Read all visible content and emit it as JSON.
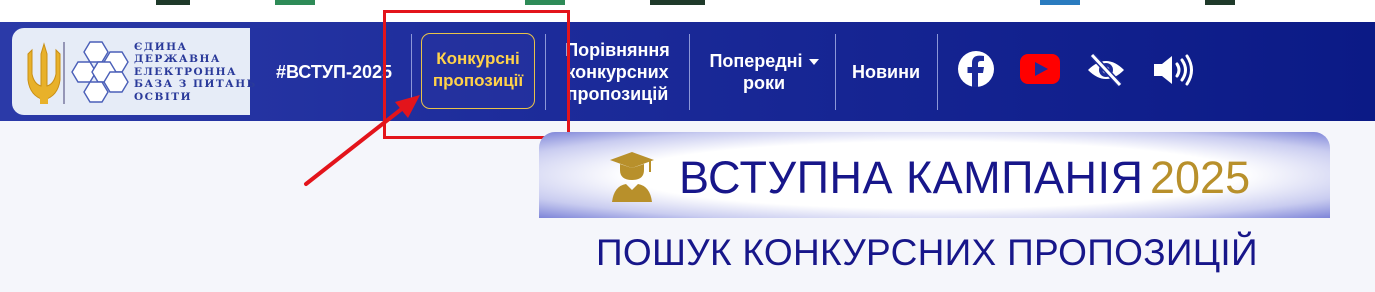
{
  "logo": {
    "lines": [
      "ЄДИНА",
      "ДЕРЖАВНА",
      "ЕЛЕКТРОННА",
      "БАЗА З ПИТАНЬ",
      "ОСВІТИ"
    ]
  },
  "nav": {
    "hashtag": "#ВСТУП-2025",
    "offers_line1": "Конкурсні",
    "offers_line2": "пропозиції",
    "compare_line1": "Порівняння",
    "compare_line2": "конкурсних",
    "compare_line3": "пропозицій",
    "previous_line1": "Попередні",
    "previous_line2": "роки",
    "news": "Новини"
  },
  "icons": [
    "facebook-icon",
    "youtube-icon",
    "eye-slash-icon",
    "volume-icon"
  ],
  "banner": {
    "title": "ВСТУПНА КАМПАНІЯ",
    "year": "2025"
  },
  "subtitle": "ПОШУК КОНКУРСНИХ ПРОПОЗИЦІЙ",
  "colors": {
    "nav_bg": "#1c2b9a",
    "active_text": "#ffd24a",
    "title_blue": "#17168a",
    "year_gold": "#b8902b",
    "annotation_red": "#e3141b"
  }
}
